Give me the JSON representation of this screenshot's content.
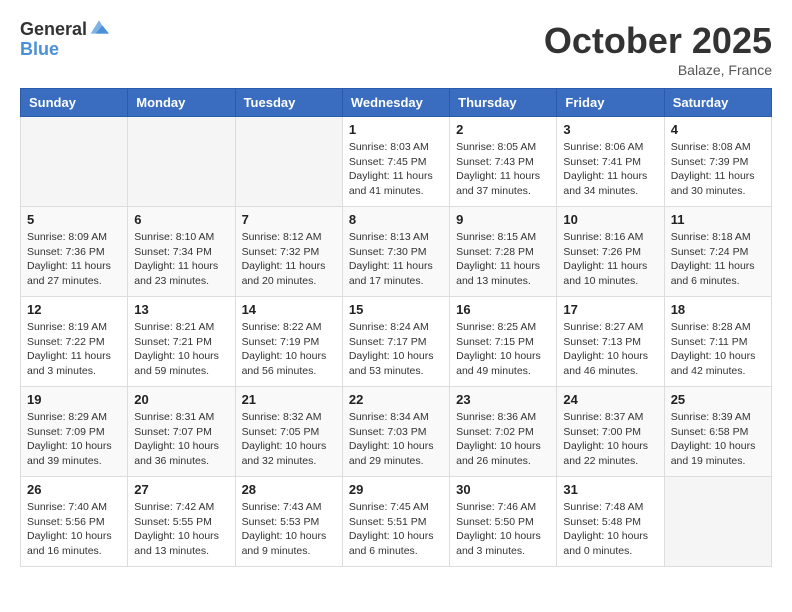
{
  "logo": {
    "general": "General",
    "blue": "Blue"
  },
  "header": {
    "month": "October 2025",
    "location": "Balaze, France"
  },
  "weekdays": [
    "Sunday",
    "Monday",
    "Tuesday",
    "Wednesday",
    "Thursday",
    "Friday",
    "Saturday"
  ],
  "weeks": [
    [
      {
        "day": "",
        "info": ""
      },
      {
        "day": "",
        "info": ""
      },
      {
        "day": "",
        "info": ""
      },
      {
        "day": "1",
        "info": "Sunrise: 8:03 AM\nSunset: 7:45 PM\nDaylight: 11 hours and 41 minutes."
      },
      {
        "day": "2",
        "info": "Sunrise: 8:05 AM\nSunset: 7:43 PM\nDaylight: 11 hours and 37 minutes."
      },
      {
        "day": "3",
        "info": "Sunrise: 8:06 AM\nSunset: 7:41 PM\nDaylight: 11 hours and 34 minutes."
      },
      {
        "day": "4",
        "info": "Sunrise: 8:08 AM\nSunset: 7:39 PM\nDaylight: 11 hours and 30 minutes."
      }
    ],
    [
      {
        "day": "5",
        "info": "Sunrise: 8:09 AM\nSunset: 7:36 PM\nDaylight: 11 hours and 27 minutes."
      },
      {
        "day": "6",
        "info": "Sunrise: 8:10 AM\nSunset: 7:34 PM\nDaylight: 11 hours and 23 minutes."
      },
      {
        "day": "7",
        "info": "Sunrise: 8:12 AM\nSunset: 7:32 PM\nDaylight: 11 hours and 20 minutes."
      },
      {
        "day": "8",
        "info": "Sunrise: 8:13 AM\nSunset: 7:30 PM\nDaylight: 11 hours and 17 minutes."
      },
      {
        "day": "9",
        "info": "Sunrise: 8:15 AM\nSunset: 7:28 PM\nDaylight: 11 hours and 13 minutes."
      },
      {
        "day": "10",
        "info": "Sunrise: 8:16 AM\nSunset: 7:26 PM\nDaylight: 11 hours and 10 minutes."
      },
      {
        "day": "11",
        "info": "Sunrise: 8:18 AM\nSunset: 7:24 PM\nDaylight: 11 hours and 6 minutes."
      }
    ],
    [
      {
        "day": "12",
        "info": "Sunrise: 8:19 AM\nSunset: 7:22 PM\nDaylight: 11 hours and 3 minutes."
      },
      {
        "day": "13",
        "info": "Sunrise: 8:21 AM\nSunset: 7:21 PM\nDaylight: 10 hours and 59 minutes."
      },
      {
        "day": "14",
        "info": "Sunrise: 8:22 AM\nSunset: 7:19 PM\nDaylight: 10 hours and 56 minutes."
      },
      {
        "day": "15",
        "info": "Sunrise: 8:24 AM\nSunset: 7:17 PM\nDaylight: 10 hours and 53 minutes."
      },
      {
        "day": "16",
        "info": "Sunrise: 8:25 AM\nSunset: 7:15 PM\nDaylight: 10 hours and 49 minutes."
      },
      {
        "day": "17",
        "info": "Sunrise: 8:27 AM\nSunset: 7:13 PM\nDaylight: 10 hours and 46 minutes."
      },
      {
        "day": "18",
        "info": "Sunrise: 8:28 AM\nSunset: 7:11 PM\nDaylight: 10 hours and 42 minutes."
      }
    ],
    [
      {
        "day": "19",
        "info": "Sunrise: 8:29 AM\nSunset: 7:09 PM\nDaylight: 10 hours and 39 minutes."
      },
      {
        "day": "20",
        "info": "Sunrise: 8:31 AM\nSunset: 7:07 PM\nDaylight: 10 hours and 36 minutes."
      },
      {
        "day": "21",
        "info": "Sunrise: 8:32 AM\nSunset: 7:05 PM\nDaylight: 10 hours and 32 minutes."
      },
      {
        "day": "22",
        "info": "Sunrise: 8:34 AM\nSunset: 7:03 PM\nDaylight: 10 hours and 29 minutes."
      },
      {
        "day": "23",
        "info": "Sunrise: 8:36 AM\nSunset: 7:02 PM\nDaylight: 10 hours and 26 minutes."
      },
      {
        "day": "24",
        "info": "Sunrise: 8:37 AM\nSunset: 7:00 PM\nDaylight: 10 hours and 22 minutes."
      },
      {
        "day": "25",
        "info": "Sunrise: 8:39 AM\nSunset: 6:58 PM\nDaylight: 10 hours and 19 minutes."
      }
    ],
    [
      {
        "day": "26",
        "info": "Sunrise: 7:40 AM\nSunset: 5:56 PM\nDaylight: 10 hours and 16 minutes."
      },
      {
        "day": "27",
        "info": "Sunrise: 7:42 AM\nSunset: 5:55 PM\nDaylight: 10 hours and 13 minutes."
      },
      {
        "day": "28",
        "info": "Sunrise: 7:43 AM\nSunset: 5:53 PM\nDaylight: 10 hours and 9 minutes."
      },
      {
        "day": "29",
        "info": "Sunrise: 7:45 AM\nSunset: 5:51 PM\nDaylight: 10 hours and 6 minutes."
      },
      {
        "day": "30",
        "info": "Sunrise: 7:46 AM\nSunset: 5:50 PM\nDaylight: 10 hours and 3 minutes."
      },
      {
        "day": "31",
        "info": "Sunrise: 7:48 AM\nSunset: 5:48 PM\nDaylight: 10 hours and 0 minutes."
      },
      {
        "day": "",
        "info": ""
      }
    ]
  ]
}
